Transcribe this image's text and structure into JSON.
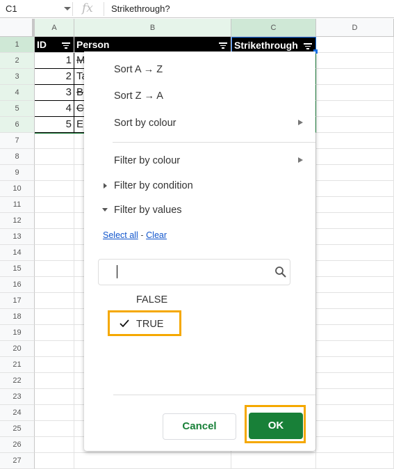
{
  "formula_bar": {
    "name_box": "C1",
    "fx_icon": "fx",
    "value": "Strikethrough?"
  },
  "columns": [
    "A",
    "B",
    "C",
    "D"
  ],
  "rows": [
    "1",
    "2",
    "3",
    "4",
    "5",
    "6",
    "7",
    "8",
    "9",
    "10",
    "11",
    "12",
    "13",
    "14",
    "15",
    "16",
    "17",
    "18",
    "19",
    "20",
    "21",
    "22",
    "23",
    "24",
    "25",
    "26",
    "27"
  ],
  "header": {
    "id": "ID",
    "person": "Person",
    "strike": "Strikethrough"
  },
  "data": [
    {
      "id": "1",
      "person": "M",
      "struck": true
    },
    {
      "id": "2",
      "person": "Ta",
      "struck": false
    },
    {
      "id": "3",
      "person": "B",
      "struck": true
    },
    {
      "id": "4",
      "person": "C",
      "struck": true
    },
    {
      "id": "5",
      "person": "E",
      "struck": false
    }
  ],
  "menu": {
    "sort_az": "Sort A → Z",
    "sort_za": "Sort Z → A",
    "sort_colour": "Sort by colour",
    "filter_colour": "Filter by colour",
    "filter_condition": "Filter by condition",
    "filter_values": "Filter by values",
    "select_all": "Select all",
    "dash": "-",
    "clear": "Clear",
    "search_value": "",
    "values": [
      {
        "label": "FALSE",
        "checked": false
      },
      {
        "label": "TRUE",
        "checked": true
      }
    ],
    "cancel": "Cancel",
    "ok": "OK"
  },
  "colors": {
    "accent": "#188038",
    "highlight": "#f5a800",
    "link": "#1155cc"
  }
}
